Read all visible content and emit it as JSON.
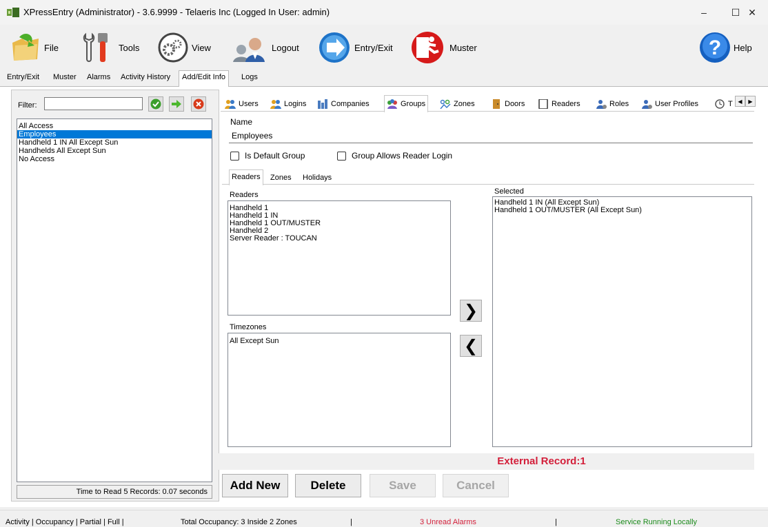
{
  "window": {
    "title": "XPressEntry (Administrator)  - 3.6.9999 - Telaeris Inc (Logged In User: admin)",
    "minimize": "–",
    "maximize": "☐",
    "close": "✕"
  },
  "toolbar": {
    "file": "File",
    "tools": "Tools",
    "view": "View",
    "logout": "Logout",
    "entry_exit": "Entry/Exit",
    "muster": "Muster",
    "help": "Help"
  },
  "main_tabs": [
    "Entry/Exit",
    "Muster",
    "Alarms",
    "Activity History",
    "Add/Edit Info",
    "Logs"
  ],
  "left": {
    "filter_label": "Filter:",
    "filter_value": "",
    "groups": [
      "All Access",
      "Employees",
      "Handheld 1 IN All Except Sun",
      "Handhelds All Except Sun",
      "No Access"
    ],
    "selected_index": 1,
    "status": "Time to Read 5 Records: 0.07 seconds"
  },
  "sub_tabs": [
    "Users",
    "Logins",
    "Companies",
    "Groups",
    "Zones",
    "Doors",
    "Readers",
    "Roles",
    "User Profiles",
    "T"
  ],
  "form": {
    "name_label": "Name",
    "name_value": "Employees",
    "is_default_group": "Is Default Group",
    "allows_reader_login": "Group Allows Reader Login"
  },
  "inner_tabs": [
    "Readers",
    "Zones",
    "Holidays"
  ],
  "readers": {
    "label": "Readers",
    "items": [
      "Handheld 1",
      "Handheld 1 IN",
      "Handheld 1 OUT/MUSTER",
      "Handheld 2",
      "Server Reader : TOUCAN"
    ]
  },
  "timezones": {
    "label": "Timezones",
    "items": [
      "All Except Sun"
    ]
  },
  "selected": {
    "label": "Selected",
    "items": [
      "Handheld 1 IN (All Except Sun)",
      "Handheld 1 OUT/MUSTER (All Except Sun)"
    ]
  },
  "arrows": {
    "add": "❯",
    "remove": "❮"
  },
  "external_record": "External Record:1",
  "actions": {
    "add_new": "Add New",
    "delete": "Delete",
    "save": "Save",
    "cancel": "Cancel"
  },
  "statusbar": {
    "tabs": "Activity | Occupancy | Partial | Full |",
    "occupancy": "Total Occupancy: 3 Inside 2 Zones",
    "sep1": "|",
    "alarms": "3 Unread Alarms",
    "sep2": "|",
    "service": "Service Running Locally"
  },
  "colors": {
    "selection": "#0078d7",
    "alarm_red": "#d31f3a",
    "service_green": "#1a8a1a",
    "help_blue": "#1560c0"
  }
}
